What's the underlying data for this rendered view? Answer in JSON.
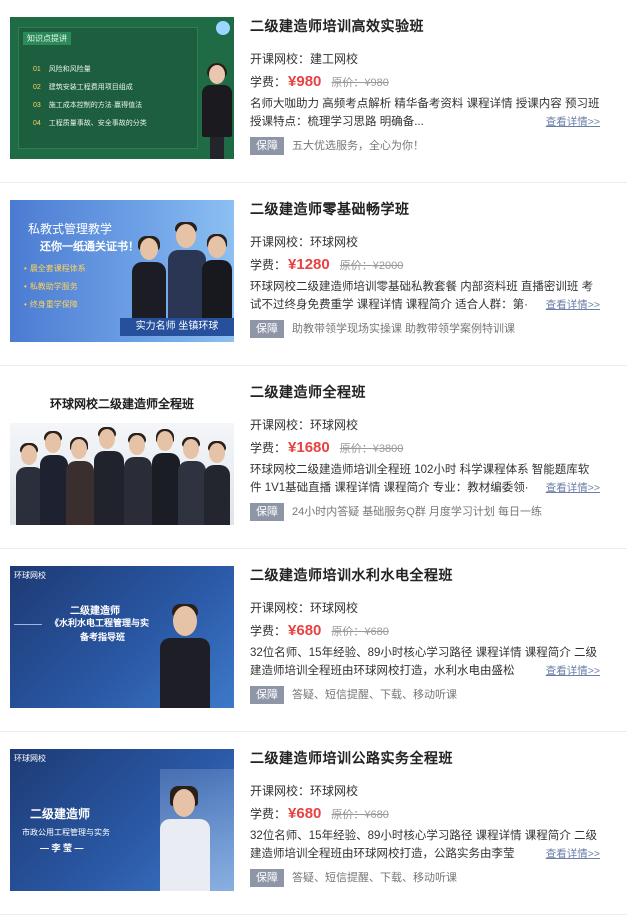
{
  "common": {
    "school_prefix": "开课网校：",
    "price_prefix": "学费：",
    "orig_prefix": "原价：",
    "currency": "¥",
    "detail_link": "查看详情>>",
    "badge": "保障"
  },
  "courses": [
    {
      "title": "二级建造师培训高效实验班",
      "school": "建工网校",
      "price": "980",
      "orig": "980",
      "desc": "名师大咖助力 高频考点解析 精华备考资料 课程详情 授课内容 预习班 授课特点：梳理学习思路 明确备...",
      "guarantee": "五大优选服务，全心为你！",
      "thumb": {
        "board_title": "知识点提讲",
        "lines": [
          {
            "num": "01",
            "text": "风险和风险量"
          },
          {
            "num": "02",
            "text": "建筑安装工程费用项目组成"
          },
          {
            "num": "03",
            "text": "施工成本控制的方法·赢得值法"
          },
          {
            "num": "04",
            "text": "工程质量事故、安全事故的分类"
          }
        ]
      }
    },
    {
      "title": "二级建造师零基础畅学班",
      "school": "环球网校",
      "price": "1280",
      "orig": "2000",
      "desc": "环球网校二级建造师培训零基础私教套餐 内部资料班 直播密训班 考试不过终身免费重学 课程详情 课程简介 适合人群：第·",
      "guarantee": "助教带领学现场实操课 助教带领学案例特训课",
      "thumb": {
        "hd": "私教式管理教学",
        "hd2": "还你一纸通关证书！",
        "bullets": [
          "晨全套课程体系",
          "私教助学服务",
          "终身重学保障"
        ],
        "bar": "实力名师 坐镇环球"
      }
    },
    {
      "title": "二级建造师全程班",
      "school": "环球网校",
      "price": "1680",
      "orig": "3800",
      "desc": "环球网校二级建造师培训全程班 102小时 科学课程体系 智能题库软件 1V1基础直播 课程详情 课程简介 专业：教材编委领·",
      "guarantee": "24小时内答疑 基础服务Q群 月度学习计划 每日一练",
      "thumb": {
        "hd": "环球网校二级建造师全程班"
      }
    },
    {
      "title": "二级建造师培训水利水电全程班",
      "school": "环球网校",
      "price": "680",
      "orig": "680",
      "desc": "32位名师、15年经验、89小时核心学习路径 课程详情 课程简介 二级建造师培训全程班由环球网校打造，水利水电由盛松",
      "guarantee": "答疑、短信提醒、下载、移动听课",
      "thumb": {
        "brand": "环球网校",
        "line1": "二级建造师",
        "line2": "《水利水电工程管理与实",
        "line3": "备考指导班"
      }
    },
    {
      "title": "二级建造师培训公路实务全程班",
      "school": "环球网校",
      "price": "680",
      "orig": "680",
      "desc": "32位名师、15年经验、89小时核心学习路径 课程详情 课程简介 二级建造师培训全程班由环球网校打造，公路实务由李莹",
      "guarantee": "答疑、短信提醒、下载、移动听课",
      "thumb": {
        "brand": "环球网校",
        "line1": "二级建造师",
        "line2": "市政公用工程管理与实务",
        "line3": "— 李 莹 —"
      }
    }
  ]
}
